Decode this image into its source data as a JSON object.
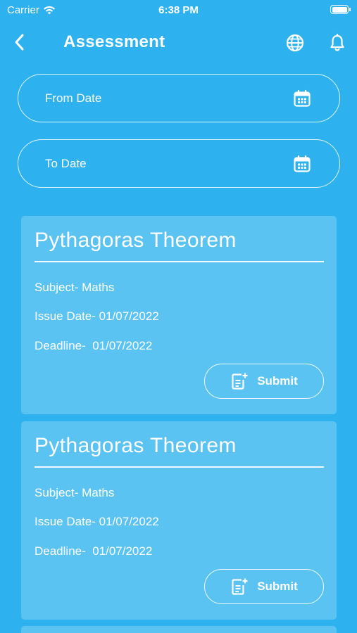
{
  "status_bar": {
    "carrier": "Carrier",
    "time": "6:38 PM"
  },
  "header": {
    "title": "Assessment",
    "icons": [
      "back-icon",
      "globe-icon",
      "bell-icon"
    ]
  },
  "filters": {
    "from_date_placeholder": "From Date",
    "to_date_placeholder": "To Date"
  },
  "assessments": [
    {
      "title": "Pythagoras Theorem",
      "subject": "Subject- Maths",
      "issue_date": "Issue Date- 01/07/2022",
      "deadline": "Deadline-  01/07/2022",
      "submit_label": "Submit"
    },
    {
      "title": "Pythagoras Theorem",
      "subject": "Subject- Maths",
      "issue_date": "Issue Date- 01/07/2022",
      "deadline": "Deadline-  01/07/2022",
      "submit_label": "Submit"
    }
  ],
  "colors": {
    "background": "#2db2ef",
    "card": "rgba(255,255,255,0.22)",
    "text": "#ffffff"
  }
}
